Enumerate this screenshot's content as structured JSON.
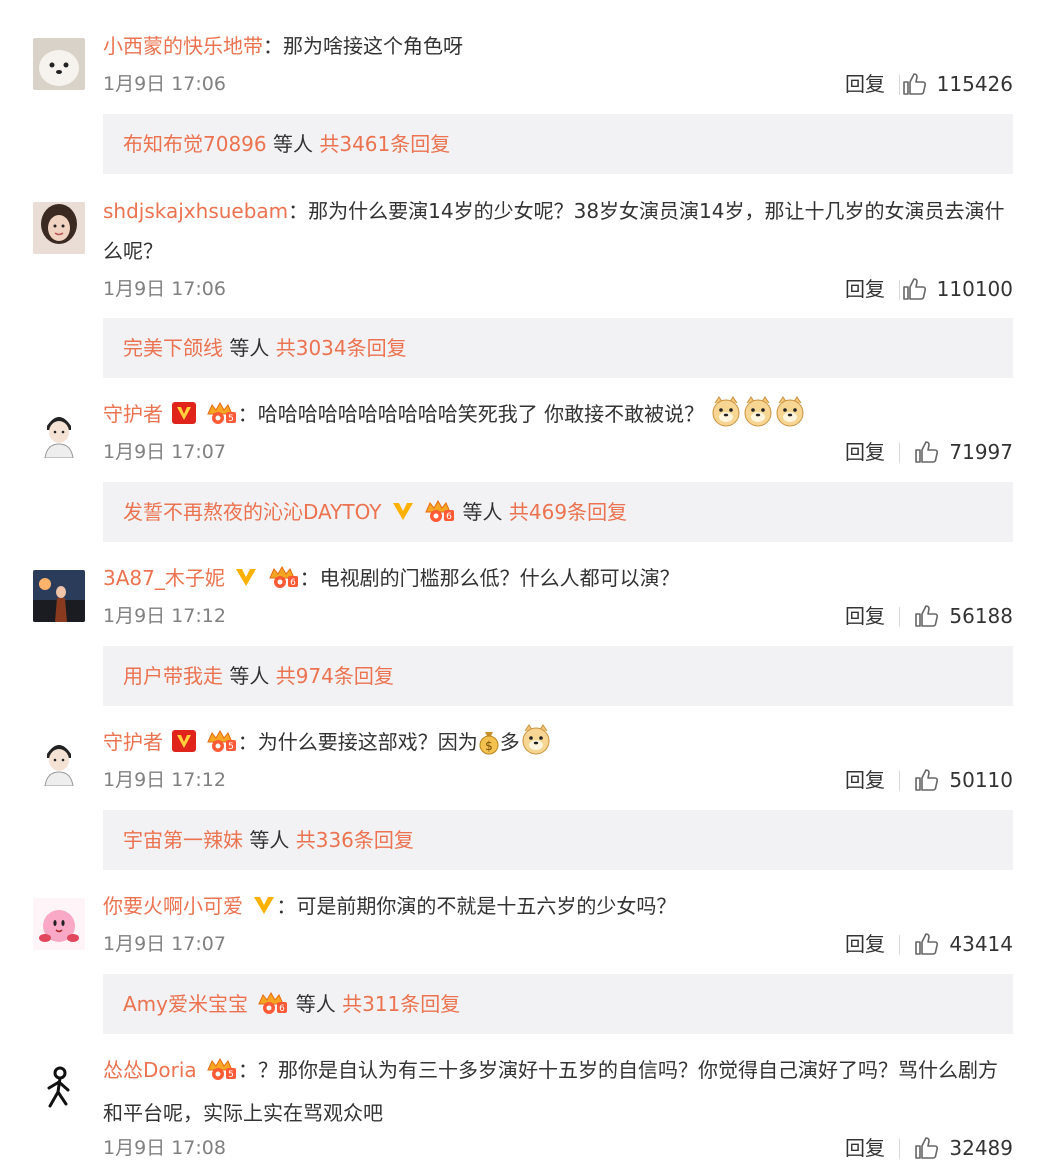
{
  "colors": {
    "accent": "#eb7350",
    "text": "#333333",
    "time": "#808080",
    "subbg": "#f2f2f5"
  },
  "comments": [
    {
      "username": "小西蒙的快乐地带",
      "text": "那为啥接这个角色呀",
      "time": "1月9日 17:06",
      "reply": "回复",
      "likes": "115426",
      "sub_name": "布知布觉70896",
      "sub_mid": " 等人 ",
      "sub_count": "共3461条回复"
    },
    {
      "username": "shdjskajxhsuebam",
      "text": "那为什么要演14岁的少女呢？38岁女演员演14岁，那让十几岁的女演员去演什么呢？",
      "time": "1月9日 17:06",
      "reply": "回复",
      "likes": "110100",
      "sub_name": "完美下颌线",
      "sub_mid": " 等人 ",
      "sub_count": "共3034条回复"
    },
    {
      "username": "守护者",
      "text": "哈哈哈哈哈哈哈哈哈哈笑死我了 你敢接不敢被说？",
      "time": "1月9日 17:07",
      "reply": "回复",
      "likes": "71997",
      "sub_name": "发誓不再熬夜的沁沁DAYTOY",
      "sub_mid": " 等人 ",
      "sub_count": "共469条回复"
    },
    {
      "username": "3A87_木子妮",
      "text": "电视剧的门槛那么低？什么人都可以演？",
      "time": "1月9日 17:12",
      "reply": "回复",
      "likes": "56188",
      "sub_name": "用户带我走",
      "sub_mid": " 等人 ",
      "sub_count": "共974条回复"
    },
    {
      "username": "守护者",
      "text_a": "为什么要接这部戏？因为",
      "text_b": "多",
      "time": "1月9日 17:12",
      "reply": "回复",
      "likes": "50110",
      "sub_name": "宇宙第一辣妹",
      "sub_mid": " 等人 ",
      "sub_count": "共336条回复"
    },
    {
      "username": "你要火啊小可爱",
      "text": "可是前期你演的不就是十五六岁的少女吗？",
      "time": "1月9日 17:07",
      "reply": "回复",
      "likes": "43414",
      "sub_name": "Amy爱米宝宝",
      "sub_mid": " 等人 ",
      "sub_count": "共311条回复"
    },
    {
      "username": "怂怂Doria",
      "text": "？那你是自认为有三十多岁演好十五岁的自信吗？你觉得自己演好了吗？骂什么剧方和平台呢，实际上实在骂观众吧",
      "time": "1月9日 17:08",
      "reply": "回复",
      "likes": "32489"
    }
  ]
}
